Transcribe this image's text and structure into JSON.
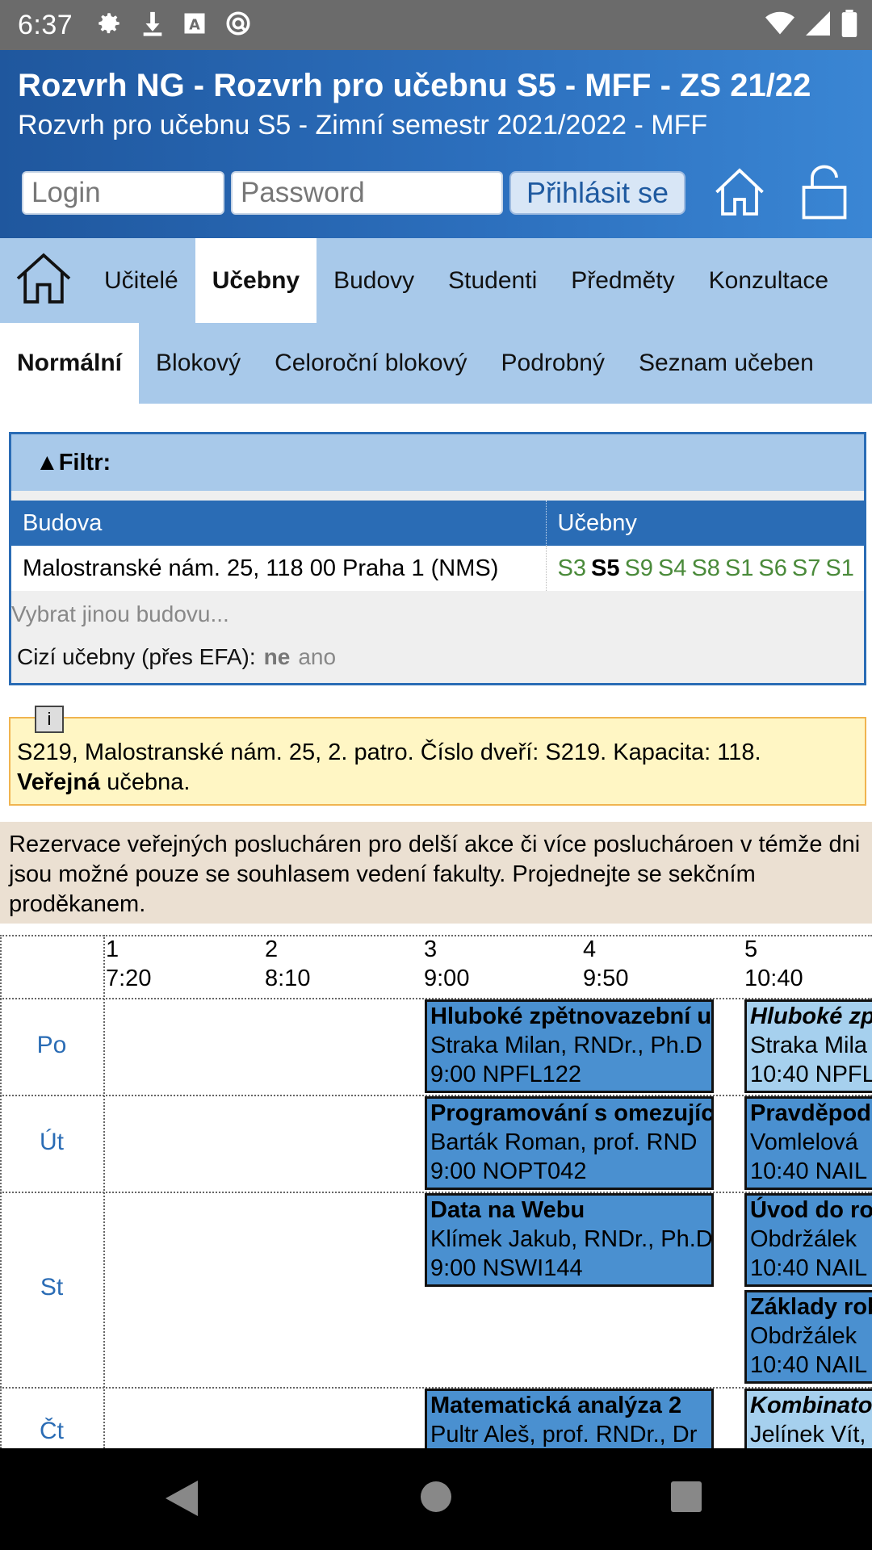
{
  "status": {
    "time": "6:37"
  },
  "header": {
    "title": "Rozvrh NG - Rozvrh pro učebnu S5 - MFF - ZS 21/22",
    "subtitle": "Rozvrh pro učebnu S5 - Zimní semestr 2021/2022 - MFF",
    "login_placeholder": "Login",
    "password_placeholder": "Password",
    "login_button": "Přihlásit se"
  },
  "mainnav": {
    "items": [
      "Učitelé",
      "Učebny",
      "Budovy",
      "Studenti",
      "Předměty",
      "Konzultace"
    ],
    "active": "Učebny"
  },
  "subnav": {
    "items": [
      "Normální",
      "Blokový",
      "Celoroční blokový",
      "Podrobný",
      "Seznam učeben"
    ],
    "active": "Normální"
  },
  "filter": {
    "title": "▲Filtr:",
    "col_building": "Budova",
    "col_rooms": "Učebny",
    "building": "Malostranské nám. 25, 118 00 Praha 1 (NMS)",
    "rooms": [
      "S3",
      "S5",
      "S9",
      "S4",
      "S8",
      "S1",
      "S6",
      "S7",
      "S1"
    ],
    "current_room": "S5",
    "other_building": "Vybrat jinou budovu...",
    "foreign_label": "Cizí učebny (přes EFA):",
    "foreign_selected": "ne",
    "foreign_option": "ano"
  },
  "info": {
    "tag": "i",
    "text1": "S219, Malostranské nám. 25, 2. patro. Číslo dveří: S219. Kapacita: 118.",
    "bold": "Veřejná",
    "text2": " učebna."
  },
  "notice": "Rezervace veřejných poslucháren pro delší akce či více posluchároen v témže dni jsou možné pouze se souhlasem vedení fakulty. Projednejte se sekčním proděkanem.",
  "schedule": {
    "slots": [
      {
        "num": "1",
        "time": "7:20"
      },
      {
        "num": "2",
        "time": "8:10"
      },
      {
        "num": "3",
        "time": "9:00"
      },
      {
        "num": "4",
        "time": "9:50"
      },
      {
        "num": "5",
        "time": "10:40"
      }
    ],
    "days": [
      "Po",
      "Út",
      "St",
      "Čt"
    ],
    "events": [
      {
        "title": "Hluboké zpětnovazební u",
        "teacher": "Straka Milan, RNDr., Ph.D",
        "time": "9:00 NPFL122"
      },
      {
        "title": "Hluboké zp",
        "teacher": "Straka Mila",
        "time": "10:40 NPFL"
      },
      {
        "title": "Programování s omezujíc",
        "teacher": "Barták Roman, prof. RND",
        "time": "9:00 NOPT042"
      },
      {
        "title": "Pravděpod",
        "teacher": "Vomlelová",
        "time": "10:40 NAIL"
      },
      {
        "title": "Data na Webu",
        "teacher": "Klímek Jakub, RNDr., Ph.D",
        "time": "9:00 NSWI144"
      },
      {
        "title": "Úvod do ro",
        "teacher": "Obdržálek",
        "time": "10:40 NAIL"
      },
      {
        "title": "Základy rob",
        "teacher": "Obdržálek",
        "time": "10:40 NAIL"
      },
      {
        "title": "Matematická analýza 2",
        "teacher": "Pultr Aleš, prof. RNDr., Dr",
        "time": ""
      },
      {
        "title": "Kombinator",
        "teacher": "Jelínek Vít,",
        "time": ""
      }
    ]
  },
  "colors": {
    "header_start": "#1f579e",
    "header_end": "#3a86d4",
    "nav": "#a8c9ea",
    "event": "#4a90d0",
    "event_light": "#a6d0ee",
    "info_bg": "#fff6c4",
    "notice_bg": "#ebe0d2"
  }
}
